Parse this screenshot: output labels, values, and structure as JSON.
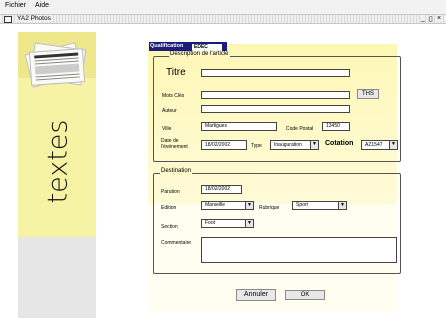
{
  "menu": {
    "fichier": "Fichier",
    "aide": "Aide"
  },
  "window": {
    "title": "YA2 Photos",
    "minimize": "_",
    "maximize": "ȩ",
    "close": "×"
  },
  "left_panel": {
    "title": "textes"
  },
  "tabs": {
    "active": "Qualification",
    "edit_value": "EDÉC"
  },
  "description": {
    "legend": "Description de l'article",
    "titre_label": "Titre",
    "motscles_label": "Mots Clés",
    "ths_button": "THS",
    "auteur_label": "Auteur",
    "ville_label": "Ville",
    "ville_value": "Martigues",
    "cp_label": "Code Postal",
    "cp_value": "13450",
    "date_label_1": "Date de",
    "date_label_2": "l'événement",
    "date_value": "18/02/2002",
    "type_label": "Type",
    "type_value": "Inauguration",
    "cotation_label": "Cotation",
    "cotation_value": "AZ1547"
  },
  "destination": {
    "legend": "Destination",
    "parution_label": "Parution",
    "parution_value": "18/02/2002",
    "edition_label": "Edition",
    "edition_value": "Marseille",
    "rubrique_label": "Rubrique",
    "rubrique_value": "Sport",
    "section_label": "Section",
    "section_value": "Foot",
    "commentaire_label": "Commentaire"
  },
  "buttons": {
    "annuler": "Annuler",
    "ok": "OK"
  }
}
